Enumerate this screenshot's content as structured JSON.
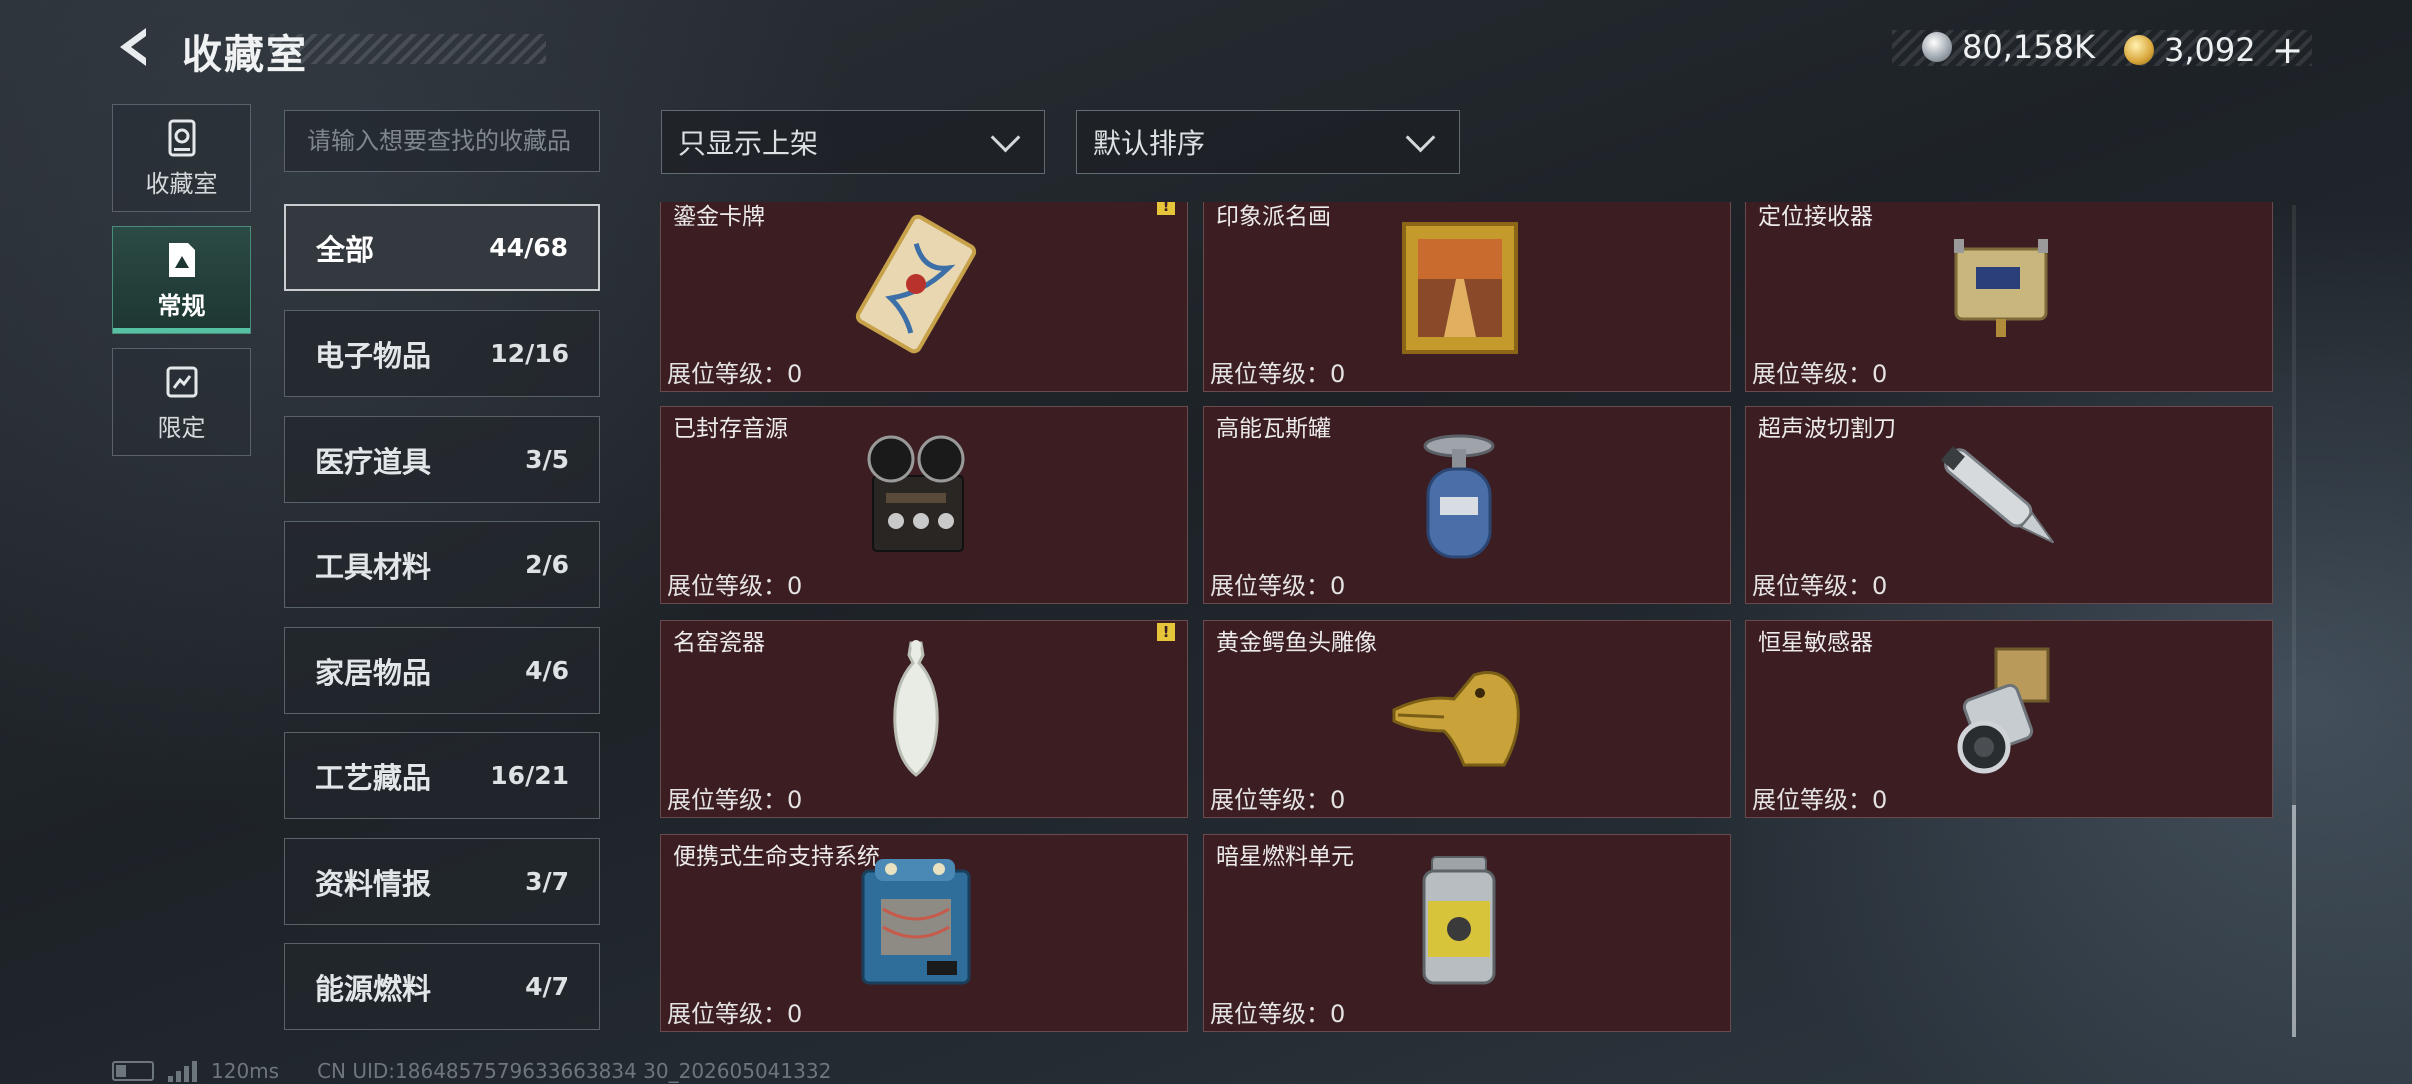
{
  "header": {
    "title": "收藏室",
    "currency_silver": "80,158K",
    "currency_gold": "3,092",
    "plus_label": "+"
  },
  "left_nav": [
    {
      "label": "收藏室",
      "icon": "vault-icon",
      "active": false
    },
    {
      "label": "常规",
      "icon": "regular-card-icon",
      "active": true
    },
    {
      "label": "限定",
      "icon": "limited-ticket-icon",
      "active": false
    }
  ],
  "search": {
    "placeholder": "请输入想要查找的收藏品"
  },
  "filters": {
    "shelf_filter": "只显示上架",
    "sort_order": "默认排序"
  },
  "subcategories": [
    {
      "name": "全部",
      "count": "44/68",
      "active": true
    },
    {
      "name": "电子物品",
      "count": "12/16"
    },
    {
      "name": "医疗道具",
      "count": "3/5"
    },
    {
      "name": "工具材料",
      "count": "2/6"
    },
    {
      "name": "家居物品",
      "count": "4/6"
    },
    {
      "name": "工艺藏品",
      "count": "16/21"
    },
    {
      "name": "资料情报",
      "count": "3/7"
    },
    {
      "name": "能源燃料",
      "count": "4/7"
    }
  ],
  "level_label": "展位等级：",
  "items": [
    {
      "name": "鎏金卡牌",
      "level": "0",
      "warning": true,
      "art": "card"
    },
    {
      "name": "印象派名画",
      "level": "0",
      "warning": false,
      "art": "painting"
    },
    {
      "name": "定位接收器",
      "level": "0",
      "warning": false,
      "art": "receiver"
    },
    {
      "name": "已封存音源",
      "level": "0",
      "warning": false,
      "art": "recorder"
    },
    {
      "name": "高能瓦斯罐",
      "level": "0",
      "warning": false,
      "art": "gas"
    },
    {
      "name": "超声波切割刀",
      "level": "0",
      "warning": false,
      "art": "blade"
    },
    {
      "name": "名窑瓷器",
      "level": "0",
      "warning": true,
      "art": "vase"
    },
    {
      "name": "黄金鳄鱼头雕像",
      "level": "0",
      "warning": false,
      "art": "croc"
    },
    {
      "name": "恒星敏感器",
      "level": "0",
      "warning": false,
      "art": "sensor"
    },
    {
      "name": "便携式生命支持系统",
      "level": "0",
      "warning": false,
      "art": "lifesupport"
    },
    {
      "name": "暗星燃料单元",
      "level": "0",
      "warning": false,
      "art": "fuel"
    }
  ],
  "footer": {
    "ping": "120ms",
    "uid": "CN UID:1864857579633663834 30_202605041332"
  },
  "colors": {
    "card_bg": "#3b1d22",
    "accent": "#56c2a3",
    "warning": "#e7c53a"
  }
}
